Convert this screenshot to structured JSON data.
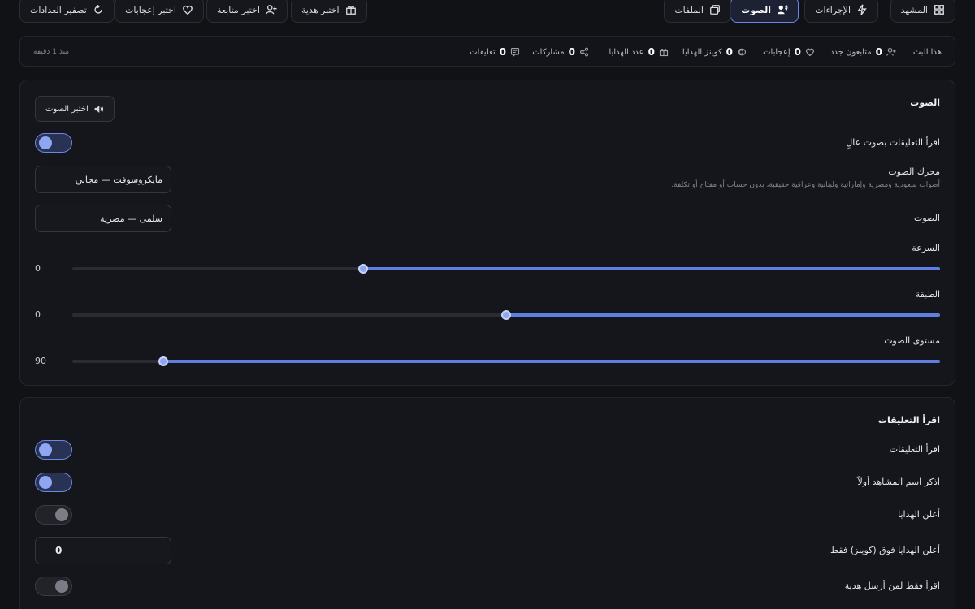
{
  "nav": {
    "scene": "المشهد",
    "actions": "الإجراءات",
    "voice": "الصوت",
    "overlays": "الملفات",
    "pick_gift": "اختبر هدية",
    "pick_follow": "اختبر متابعة",
    "pick_likes": "اختبر إعجابات",
    "reset_counters": "تصفير العدادات"
  },
  "stats": {
    "live_label": "هذا البث",
    "new_followers": {
      "value": "0",
      "label": "متابعون جدد"
    },
    "likes": {
      "value": "0",
      "label": "إعجابات"
    },
    "gift_coins": {
      "value": "0",
      "label": "كوينز الهدايا"
    },
    "gift_count": {
      "value": "0",
      "label": "عدد الهدايا"
    },
    "shares": {
      "value": "0",
      "label": "مشاركات"
    },
    "comments": {
      "value": "0",
      "label": "تعليقات"
    },
    "since": "منذ 1 دقيقة"
  },
  "voice_card": {
    "title": "الصوت",
    "test_voice_button": "اختبر الصوت",
    "read_aloud_label": "اقرأ التعليقات بصوت عالٍ",
    "engine_label": "محرك الصوت",
    "engine_hint": "أصوات سعودية ومصرية وإماراتية ولبنانية وعراقية حقيقية، بدون حساب أو مفتاح أو تكلفة.",
    "engine_value": "مايكروسوفت — مجاني",
    "voice_label": "الصوت",
    "voice_value": "سلمى — مصرية",
    "speed_label": "السرعة",
    "speed_value": "0",
    "speed_level": 0.665,
    "pitch_label": "الطبقة",
    "pitch_value": "0",
    "pitch_level": 0.5,
    "volume_label": "مستوى الصوت",
    "volume_value": "90",
    "volume_level": 0.895
  },
  "comments_card": {
    "title": "اقرأ التعليقات",
    "read_comments_label": "اقرأ التعليقات",
    "viewer_name_first_label": "اذكر اسم المشاهد أولاً",
    "announce_gifts_label": "أعلن الهدايا",
    "announce_above_label": "أعلن الهدايا فوق (كوينز) فقط",
    "announce_above_value": "0",
    "only_gifters_label": "اقرأ فقط لمن أرسل هدية"
  },
  "colors": {
    "accent": "#5f7fe0",
    "background": "#111216",
    "card": "#15161b"
  }
}
